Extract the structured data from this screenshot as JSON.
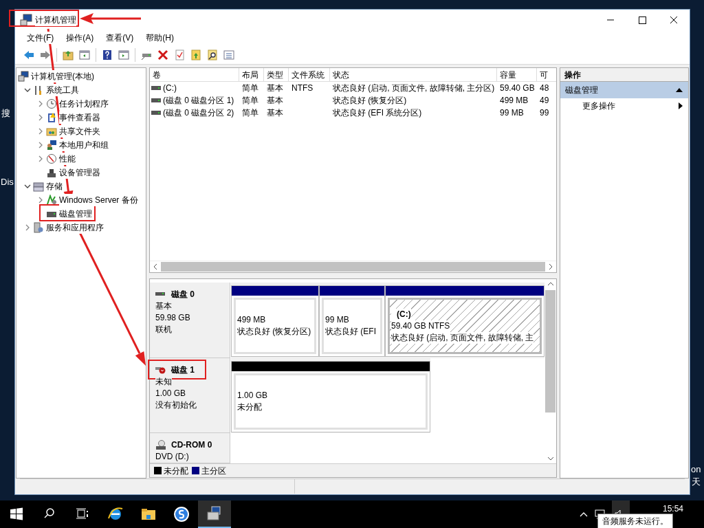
{
  "desktop": {
    "left_labels": [
      "搜",
      "Dis"
    ],
    "right_labels": [
      "on",
      "天"
    ]
  },
  "window": {
    "title": "计算机管理"
  },
  "menu": [
    "文件(F)",
    "操作(A)",
    "查看(V)",
    "帮助(H)"
  ],
  "tree": [
    {
      "label": "计算机管理(本地)",
      "children": [
        {
          "label": "系统工具",
          "expanded": true,
          "children": [
            {
              "label": "任务计划程序",
              "expanded": false
            },
            {
              "label": "事件查看器",
              "expanded": false
            },
            {
              "label": "共享文件夹",
              "expanded": false
            },
            {
              "label": "本地用户和组",
              "expanded": false
            },
            {
              "label": "性能",
              "expanded": false
            },
            {
              "label": "设备管理器"
            }
          ]
        },
        {
          "label": "存储",
          "expanded": true,
          "children": [
            {
              "label": "Windows Server 备份",
              "expanded": false
            },
            {
              "label": "磁盘管理"
            }
          ]
        },
        {
          "label": "服务和应用程序",
          "expanded": false
        }
      ]
    }
  ],
  "table": {
    "columns": [
      "卷",
      "布局",
      "类型",
      "文件系统",
      "状态",
      "容量",
      "可"
    ],
    "rows": [
      [
        "(C:)",
        "简单",
        "基本",
        "NTFS",
        "状态良好 (启动, 页面文件, 故障转储, 主分区)",
        "59.40 GB",
        "48"
      ],
      [
        "(磁盘 0 磁盘分区 1)",
        "简单",
        "基本",
        "",
        "状态良好 (恢复分区)",
        "499 MB",
        "49"
      ],
      [
        "(磁盘 0 磁盘分区 2)",
        "简单",
        "基本",
        "",
        "状态良好 (EFI 系统分区)",
        "99 MB",
        "99"
      ]
    ]
  },
  "disks": [
    {
      "kind": "basic",
      "name": "磁盘 0",
      "lines": [
        "基本",
        "59.98 GB",
        "联机"
      ],
      "partitions": [
        {
          "kind": "primary",
          "selected": false,
          "size": "499 MB",
          "status": "状态良好 (恢复分区)"
        },
        {
          "kind": "primary",
          "selected": false,
          "size": "99 MB",
          "status": "状态良好 (EFI"
        },
        {
          "kind": "primary",
          "selected": true,
          "name": "(C:)",
          "size": "59.40 GB NTFS",
          "status": "状态良好 (启动, 页面文件, 故障转储, 主"
        }
      ]
    },
    {
      "kind": "unknown",
      "name": "磁盘 1",
      "lines": [
        "未知",
        "1.00 GB",
        "没有初始化"
      ],
      "partitions": [
        {
          "kind": "unallocated",
          "selected": false,
          "size": "1.00 GB",
          "status": "未分配"
        }
      ]
    },
    {
      "kind": "cdrom",
      "name": "CD-ROM 0",
      "lines": [
        "DVD (D:)"
      ]
    }
  ],
  "legend": [
    {
      "label": "未分配",
      "color": "#000000"
    },
    {
      "label": "主分区",
      "color": "#000080"
    }
  ],
  "actions": {
    "header": "操作",
    "section": "磁盘管理",
    "items": [
      "更多操作"
    ]
  },
  "taskbar": {
    "clock": "15:54",
    "tooltip": "音频服务未运行。"
  }
}
